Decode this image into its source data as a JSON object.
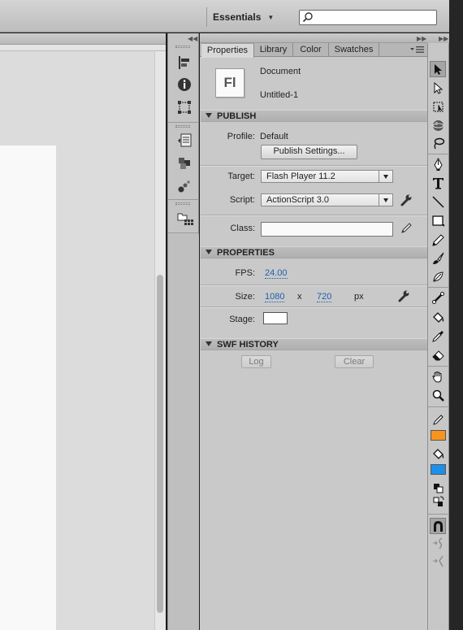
{
  "workspace": {
    "label": "Essentials",
    "search_placeholder": ""
  },
  "panel": {
    "tabs": [
      {
        "label": "Properties",
        "active": true
      },
      {
        "label": "Library",
        "active": false
      },
      {
        "label": "Color",
        "active": false
      },
      {
        "label": "Swatches",
        "active": false
      }
    ],
    "doc": {
      "icon_text": "Fl",
      "type": "Document",
      "name": "Untitled-1"
    },
    "publish": {
      "title": "PUBLISH",
      "profile_label": "Profile:",
      "profile_value": "Default",
      "publish_settings_btn": "Publish Settings...",
      "target_label": "Target:",
      "target_value": "Flash Player 11.2",
      "script_label": "Script:",
      "script_value": "ActionScript 3.0",
      "class_label": "Class:",
      "class_value": ""
    },
    "properties": {
      "title": "PROPERTIES",
      "fps_label": "FPS:",
      "fps_value": "24.00",
      "size_label": "Size:",
      "width": "1080",
      "x_sep": "x",
      "height": "720",
      "unit": "px",
      "stage_label": "Stage:",
      "stage_color": "#ffffff"
    },
    "swf_history": {
      "title": "SWF HISTORY",
      "log_btn": "Log",
      "clear_btn": "Clear"
    }
  },
  "tools": {
    "stroke_color": "#333333",
    "fill_color_1": "#f7941d",
    "fill_color_2": "#1e8fe8",
    "items": [
      "selection-tool",
      "subselection-tool",
      "free-transform-tool",
      "3d-rotation-tool",
      "lasso-tool",
      "pen-tool",
      "text-tool",
      "line-tool",
      "rectangle-tool",
      "pencil-tool",
      "brush-tool",
      "deco-tool",
      "bone-tool",
      "paint-bucket-tool",
      "eyedropper-tool",
      "eraser-tool",
      "hand-tool",
      "zoom-tool"
    ]
  },
  "colors": {
    "accent_orange": "#f7941d",
    "accent_blue": "#1e8fe8",
    "link_blue": "#1f5fae"
  }
}
